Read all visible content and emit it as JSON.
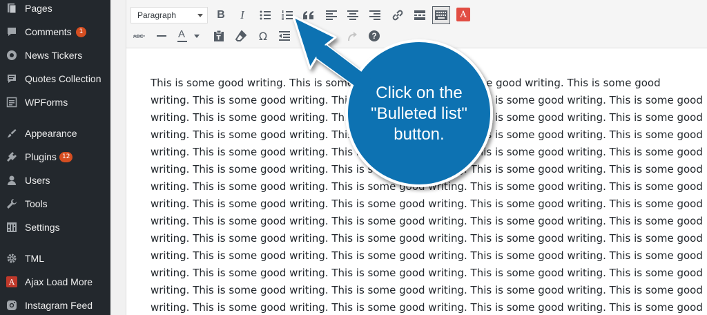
{
  "sidebar": {
    "items": [
      {
        "label": "Pages",
        "icon": "pages-icon"
      },
      {
        "label": "Comments",
        "icon": "comments-icon",
        "badge": "1"
      },
      {
        "label": "News Tickers",
        "icon": "news-ticker-icon"
      },
      {
        "label": "Quotes Collection",
        "icon": "quotes-icon"
      },
      {
        "label": "WPForms",
        "icon": "wpforms-icon"
      },
      {
        "label": "Appearance",
        "icon": "appearance-icon"
      },
      {
        "label": "Plugins",
        "icon": "plugins-icon",
        "badge": "12"
      },
      {
        "label": "Users",
        "icon": "users-icon"
      },
      {
        "label": "Tools",
        "icon": "tools-icon"
      },
      {
        "label": "Settings",
        "icon": "settings-icon"
      },
      {
        "label": "TML",
        "icon": "tml-gear-icon"
      },
      {
        "label": "Ajax Load More",
        "icon": "ajax-load-more-icon",
        "icon_text": "A"
      },
      {
        "label": "Instagram Feed",
        "icon": "instagram-icon"
      }
    ]
  },
  "toolbar": {
    "format_select": "Paragraph",
    "bold_glyph": "B",
    "italic_glyph": "I",
    "omega_glyph": "Ω",
    "help_glyph": "?",
    "text_color_glyph": "A",
    "a_red_glyph": "A"
  },
  "content": {
    "lines": [
      "This is some good writing. This is some good writing. This is some good writing. This is some good",
      "writing. This is some good writing. This is some good writing. This is some good writing. This is some good",
      "writing. This is some good writing. This is some good writing. This is some good writing. This is some good",
      "writing. This is some good writing. This is some good writing. This is some good writing. This is some good",
      "writing. This is some good writing. This is some good writing. This is some good writing. This is some good",
      "writing. This is some good writing. This is some good writing. This is some good writing. This is some good",
      "writing. This is some good writing. This is some good writing. This is some good writing. This is some good",
      "writing. This is some good writing. This is some good writing. This is some good writing. This is some good",
      "writing. This is some good writing. This is some good writing. This is some good writing. This is some good",
      "writing. This is some good writing. This is some good writing. This is some good writing. This is some good",
      "writing. This is some good writing. This is some good writing. This is some good writing. This is some good",
      "writing. This is some good writing. This is some good writing. This is some good writing. This is some good",
      "writing. This is some good writing. This is some good writing. This is some good writing. This is some good",
      "writing. This is some good writing. This is some good writing. This is some good writing. This is some good"
    ]
  },
  "callout": {
    "text": "Click on the \"Bulleted list\" button.",
    "color": "#0a72b2"
  },
  "colors": {
    "sidebar_bg": "#23282d",
    "badge": "#d54e21",
    "accent_red": "#e14d43"
  }
}
